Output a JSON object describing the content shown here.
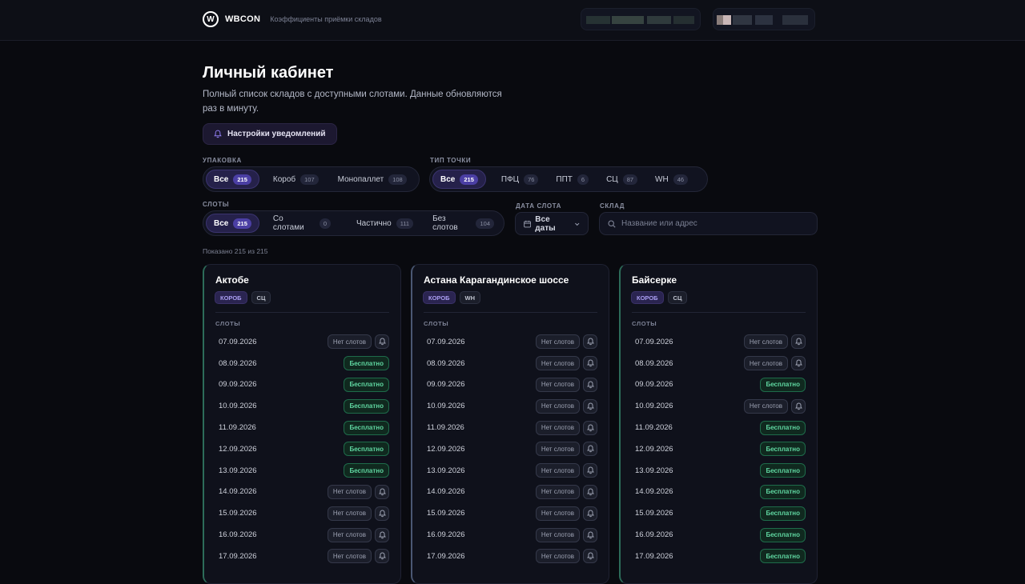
{
  "header": {
    "logo_mark": "W",
    "logo_text": "WBCON",
    "subtitle": "Коэффициенты приёмки складов"
  },
  "page": {
    "title": "Личный кабинет",
    "description": "Полный список складов с доступными слотами. Данные обновляются раз в минуту.",
    "notify_button": "Настройки уведомлений"
  },
  "filters": {
    "packaging": {
      "label": "УПАКОВКА",
      "options": [
        {
          "label": "Все",
          "count": "215",
          "active": true
        },
        {
          "label": "Короб",
          "count": "107",
          "active": false
        },
        {
          "label": "Монопаллет",
          "count": "108",
          "active": false
        }
      ]
    },
    "point_type": {
      "label": "ТИП ТОЧКИ",
      "options": [
        {
          "label": "Все",
          "count": "215",
          "active": true
        },
        {
          "label": "ПФЦ",
          "count": "76",
          "active": false
        },
        {
          "label": "ППТ",
          "count": "6",
          "active": false
        },
        {
          "label": "СЦ",
          "count": "87",
          "active": false
        },
        {
          "label": "WH",
          "count": "46",
          "active": false
        }
      ]
    },
    "slots": {
      "label": "СЛОТЫ",
      "options": [
        {
          "label": "Все",
          "count": "215",
          "active": true
        },
        {
          "label": "Со слотами",
          "count": "0",
          "active": false
        },
        {
          "label": "Частично",
          "count": "111",
          "active": false
        },
        {
          "label": "Без слотов",
          "count": "104",
          "active": false
        }
      ]
    },
    "slot_date": {
      "label": "ДАТА СЛОТА",
      "value": "Все даты"
    },
    "warehouse": {
      "label": "СКЛАД",
      "placeholder": "Название или адрес"
    }
  },
  "shown_text": "Показано 215 из 215",
  "slot_labels": {
    "none": "Нет слотов",
    "free": "Бесплатно"
  },
  "cards": [
    {
      "title": "Актобе",
      "tags": [
        "КОРОБ",
        "СЦ"
      ],
      "slots_label": "СЛОТЫ",
      "slots": [
        {
          "date": "07.09.2026",
          "status": "none"
        },
        {
          "date": "08.09.2026",
          "status": "free"
        },
        {
          "date": "09.09.2026",
          "status": "free"
        },
        {
          "date": "10.09.2026",
          "status": "free"
        },
        {
          "date": "11.09.2026",
          "status": "free"
        },
        {
          "date": "12.09.2026",
          "status": "free"
        },
        {
          "date": "13.09.2026",
          "status": "free"
        },
        {
          "date": "14.09.2026",
          "status": "none"
        },
        {
          "date": "15.09.2026",
          "status": "none"
        },
        {
          "date": "16.09.2026",
          "status": "none"
        },
        {
          "date": "17.09.2026",
          "status": "none"
        }
      ]
    },
    {
      "title": "Астана Карагандинское шоссе",
      "tags": [
        "КОРОБ",
        "WH"
      ],
      "slots_label": "СЛОТЫ",
      "slots": [
        {
          "date": "07.09.2026",
          "status": "none"
        },
        {
          "date": "08.09.2026",
          "status": "none"
        },
        {
          "date": "09.09.2026",
          "status": "none"
        },
        {
          "date": "10.09.2026",
          "status": "none"
        },
        {
          "date": "11.09.2026",
          "status": "none"
        },
        {
          "date": "12.09.2026",
          "status": "none"
        },
        {
          "date": "13.09.2026",
          "status": "none"
        },
        {
          "date": "14.09.2026",
          "status": "none"
        },
        {
          "date": "15.09.2026",
          "status": "none"
        },
        {
          "date": "16.09.2026",
          "status": "none"
        },
        {
          "date": "17.09.2026",
          "status": "none"
        }
      ]
    },
    {
      "title": "Байсерке",
      "tags": [
        "КОРОБ",
        "СЦ"
      ],
      "slots_label": "СЛОТЫ",
      "slots": [
        {
          "date": "07.09.2026",
          "status": "none"
        },
        {
          "date": "08.09.2026",
          "status": "none"
        },
        {
          "date": "09.09.2026",
          "status": "free"
        },
        {
          "date": "10.09.2026",
          "status": "none"
        },
        {
          "date": "11.09.2026",
          "status": "free"
        },
        {
          "date": "12.09.2026",
          "status": "free"
        },
        {
          "date": "13.09.2026",
          "status": "free"
        },
        {
          "date": "14.09.2026",
          "status": "free"
        },
        {
          "date": "15.09.2026",
          "status": "free"
        },
        {
          "date": "16.09.2026",
          "status": "free"
        },
        {
          "date": "17.09.2026",
          "status": "free"
        }
      ]
    }
  ],
  "colors": {
    "background": "#090a0f",
    "accent": "#4b3fa4",
    "free_text": "#5fd6a0",
    "card_border_green": "#2d6c59"
  }
}
